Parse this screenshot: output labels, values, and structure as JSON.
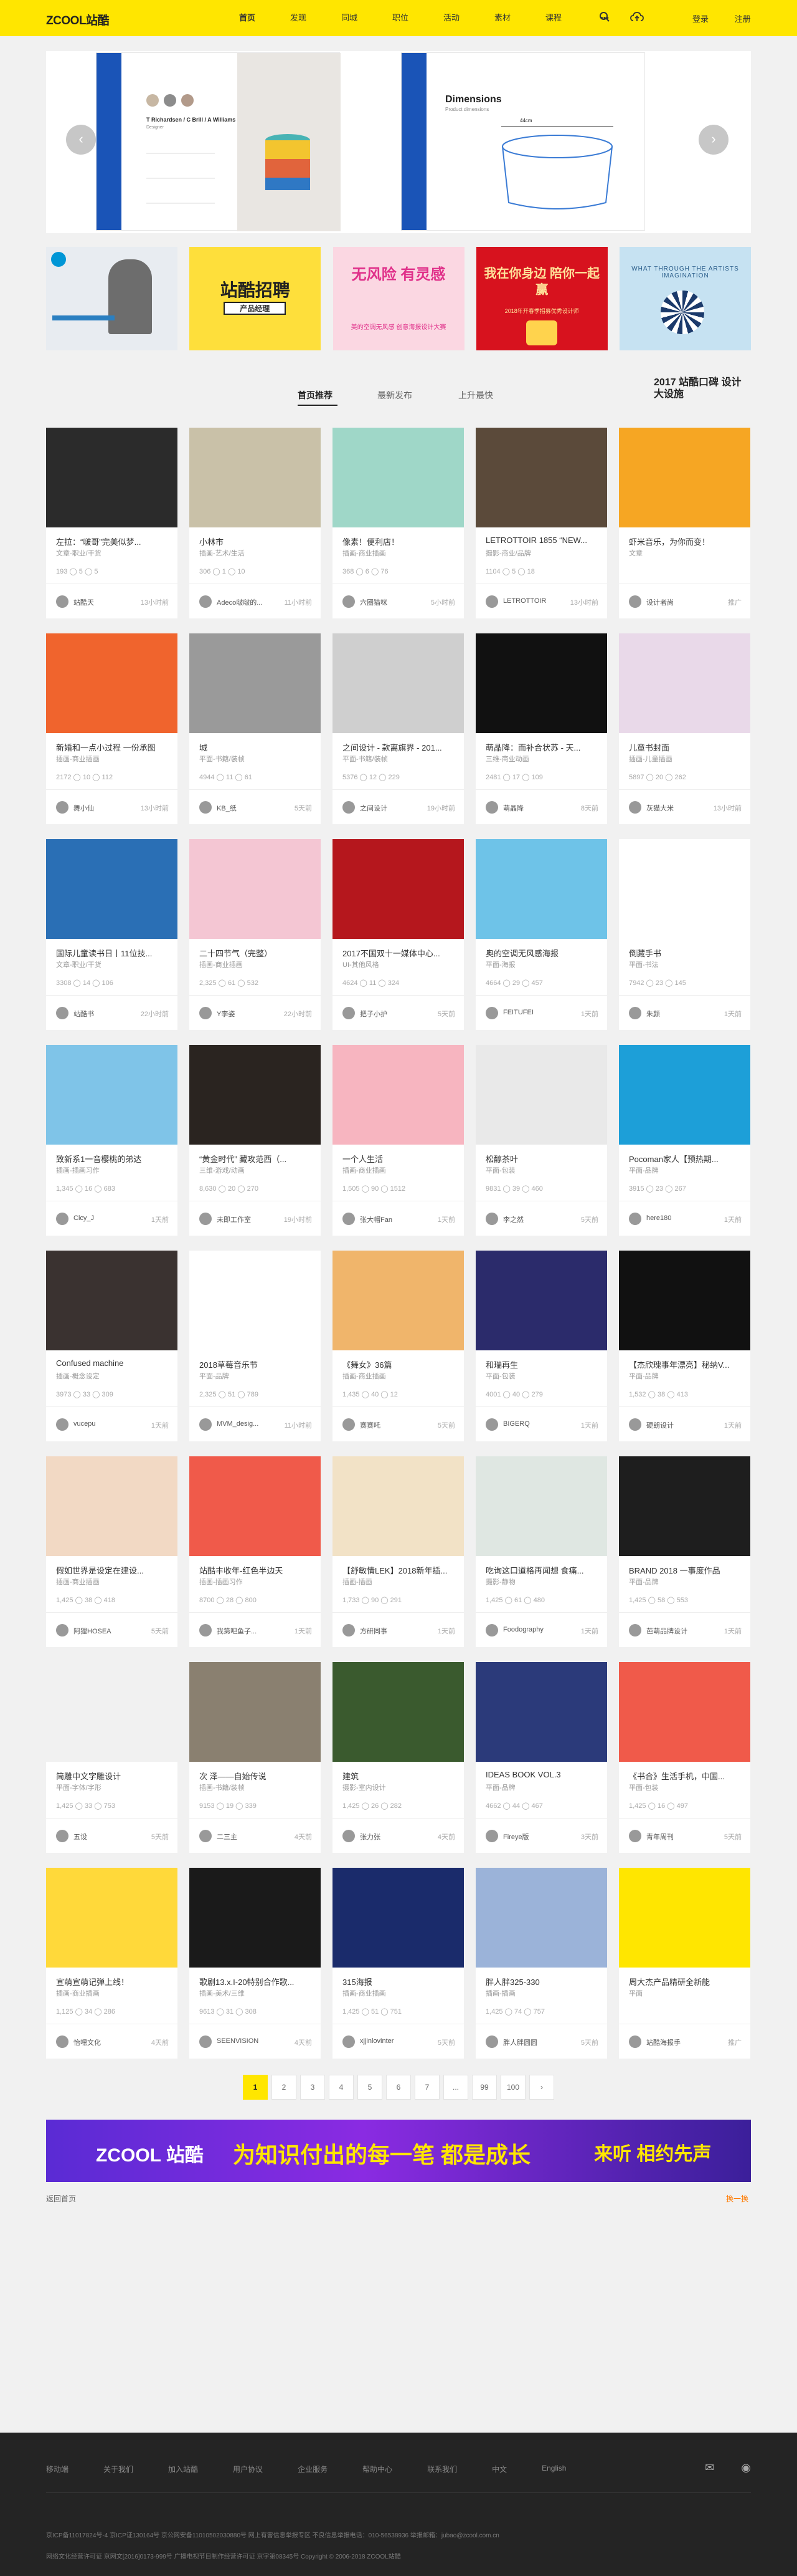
{
  "header": {
    "logo_en": "ZCOOL",
    "logo_cn": "站酷",
    "nav": [
      "首页",
      "发现",
      "同城",
      "职位",
      "活动",
      "素材",
      "课程"
    ],
    "more": "•••",
    "login": "登录",
    "register": "注册"
  },
  "banner": {
    "card1_name": "T Richardsen / C Brill / A Williams",
    "card1_role": "Designer",
    "card2_title": "Dimensions",
    "card2_sub": "Product dimensions",
    "card2_measure": "44cm"
  },
  "ads": [
    {
      "text": ""
    },
    {
      "text": "站酷招聘",
      "sub": "产品经理"
    },
    {
      "text": "无风险 有灵感",
      "sub": "美的空调无风感 创意海报设计大赛"
    },
    {
      "text": "我在你身边 陪你一起赢",
      "sub": "2018年开春季招募优秀设计师"
    },
    {
      "text": "WHAT THROUGH THE ARTISTS IMAGINATION"
    }
  ],
  "tabs": {
    "t1": "首页推荐",
    "t2": "最新发布",
    "t3": "上升最快",
    "badge": "2017 站酷口碑 设计 大设施"
  },
  "cards": [
    [
      {
        "title": "左拉：“啵哥”完美似梦...",
        "cat": "文章-职业/干货",
        "s": "193 ◯ 5 ◯ 5",
        "au": "站酷天",
        "tm": "13小时前"
      },
      {
        "title": "小林市",
        "cat": "插画-艺术/生活",
        "s": "306 ◯ 1 ◯ 10",
        "au": "Adeco啵啵的...",
        "tm": "11小时前"
      },
      {
        "title": "像素！便利店！",
        "cat": "插画-商业插画",
        "s": "368 ◯ 6 ◯ 76",
        "au": "六圈猫咪",
        "tm": "5小时前"
      },
      {
        "title": "LETROTTOIR 1855 “NEW...",
        "cat": "摄影-商业/品牌",
        "s": "1104 ◯ 5 ◯ 18",
        "au": "LETROTTOIR",
        "tm": "13小时前"
      },
      {
        "title": "虾米音乐，为你而变！",
        "cat": "文章",
        "s": "",
        "au": "设计者尚",
        "tm": "推广"
      }
    ],
    [
      {
        "title": "新婚和一点小过程 一份承图",
        "cat": "插画-商业插画",
        "s": "2172 ◯ 10 ◯ 112",
        "au": "舞小仙",
        "tm": "13小时前"
      },
      {
        "title": "城",
        "cat": "平面-书籍/装帧",
        "s": "4944 ◯ 11 ◯ 61",
        "au": "KB_纸",
        "tm": "5天前"
      },
      {
        "title": "之间设计 - 款离旗界 - 201...",
        "cat": "平面-书籍/装帧",
        "s": "5376 ◯ 12 ◯ 229",
        "au": "之间设计",
        "tm": "19小时前"
      },
      {
        "title": "萌晶降：而补合状苏 - 天...",
        "cat": "三维-商业动画",
        "s": "2481 ◯ 17 ◯ 109",
        "au": "萌晶降",
        "tm": "8天前"
      },
      {
        "title": "儿童书封面",
        "cat": "插画-儿童插画",
        "s": "5897 ◯ 20 ◯ 262",
        "au": "灰猫大米",
        "tm": "13小时前"
      }
    ],
    [
      {
        "title": "国际儿童读书日丨11位技...",
        "cat": "文章-职业/干货",
        "s": "3308 ◯ 14 ◯ 106",
        "au": "站酷书",
        "tm": "22小时前"
      },
      {
        "title": "二十四节气（完整）",
        "cat": "插画-商业插画",
        "s": "2,325 ◯ 61 ◯ 532",
        "au": "Y李姿",
        "tm": "22小时前"
      },
      {
        "title": "2017不国双十一媒体中心...",
        "cat": "UI-其他风格",
        "s": "4624 ◯ 11 ◯ 324",
        "au": "把子小护",
        "tm": "5天前"
      },
      {
        "title": "奥的空调无风感海报",
        "cat": "平面-海报",
        "s": "4664 ◯ 29 ◯ 457",
        "au": "FEITUFEI",
        "tm": "1天前"
      },
      {
        "title": "倒藏手书",
        "cat": "平面-书法",
        "s": "7942 ◯ 23 ◯ 145",
        "au": "朱颜",
        "tm": "1天前"
      }
    ],
    [
      {
        "title": "致新系1一音樱桃的弟达",
        "cat": "插画-插画习作",
        "s": "1,345 ◯ 16 ◯ 683",
        "au": "Cicy_J",
        "tm": "1天前"
      },
      {
        "title": "“黄金时代” 藏攻范西（...",
        "cat": "三维-游戏/动画",
        "s": "8,630 ◯ 20 ◯ 270",
        "au": "未即工作室",
        "tm": "19小时前"
      },
      {
        "title": "一个人生活",
        "cat": "插画-商业插画",
        "s": "1,505 ◯ 90 ◯ 1512",
        "au": "张大帽Fan",
        "tm": "1天前"
      },
      {
        "title": "松醇茶叶",
        "cat": "平面-包装",
        "s": "9831 ◯ 39 ◯ 460",
        "au": "李之然",
        "tm": "5天前"
      },
      {
        "title": "Pocoman家人【预热期...",
        "cat": "平面-品牌",
        "s": "3915 ◯ 23 ◯ 267",
        "au": "here180",
        "tm": "1天前"
      }
    ],
    [
      {
        "title": "Confused machine",
        "cat": "插画-概念设定",
        "s": "3973 ◯ 33 ◯ 309",
        "au": "vucepu",
        "tm": "1天前"
      },
      {
        "title": "2018草莓音乐节",
        "cat": "平面-品牌",
        "s": "2,325 ◯ 51 ◯ 789",
        "au": "MVM_desig...",
        "tm": "11小时前"
      },
      {
        "title": "《舞女》36篇",
        "cat": "插画-商业插画",
        "s": "1,435 ◯ 40 ◯ 12",
        "au": "赛赛吒",
        "tm": "5天前"
      },
      {
        "title": "和瑞再生",
        "cat": "平面-包装",
        "s": "4001 ◯ 40 ◯ 279",
        "au": "BIGERQ",
        "tm": "1天前"
      },
      {
        "title": "【杰欣瑰事年漂亮】秘纳V...",
        "cat": "平面-品牌",
        "s": "1,532 ◯ 38 ◯ 413",
        "au": "硬朗设计",
        "tm": "1天前"
      }
    ],
    [
      {
        "title": "假如世界是设定在建设...",
        "cat": "插画-商业插画",
        "s": "1,425 ◯ 38 ◯ 418",
        "au": "阿狸HOSEA",
        "tm": "5天前"
      },
      {
        "title": "站酷丰收年-红色半边天",
        "cat": "插画-插画习作",
        "s": "8700 ◯ 28 ◯ 800",
        "au": "我第吧鱼子...",
        "tm": "1天前"
      },
      {
        "title": "【舒敏情LEK】2018新年插...",
        "cat": "插画-插画",
        "s": "1,733 ◯ 90 ◯ 291",
        "au": "方研同事",
        "tm": "1天前"
      },
      {
        "title": "吃询这口道格再闻想 食痛...",
        "cat": "摄影-静物",
        "s": "1,425 ◯ 61 ◯ 480",
        "au": "Foodography",
        "tm": "1天前"
      },
      {
        "title": "BRAND 2018 一事度作品",
        "cat": "平面-品牌",
        "s": "1,425 ◯ 58 ◯ 553",
        "au": "芭萌品牌设计",
        "tm": "1天前"
      }
    ],
    [
      {
        "title": "简雕中文字雕设计",
        "cat": "平面-字体/字形",
        "s": "1,425 ◯ 33 ◯ 753",
        "au": "五设",
        "tm": "5天前"
      },
      {
        "title": "次 泽——自始传说",
        "cat": "插画-书籍/装帧",
        "s": "9153 ◯ 19 ◯ 339",
        "au": "二三主",
        "tm": "4天前"
      },
      {
        "title": "建筑",
        "cat": "摄影-室内设计",
        "s": "1,425 ◯ 26 ◯ 282",
        "au": "张力张",
        "tm": "4天前"
      },
      {
        "title": "IDEAS BOOK VOL.3",
        "cat": "平面-品牌",
        "s": "4662 ◯ 44 ◯ 467",
        "au": "Fireye版",
        "tm": "3天前"
      },
      {
        "title": "《书合》生活手机，中国...",
        "cat": "平面-包装",
        "s": "1,425 ◯ 16 ◯ 497",
        "au": "青年周刊",
        "tm": "5天前"
      }
    ],
    [
      {
        "title": "宣萌宣萌记弹上线！",
        "cat": "插画-商业插画",
        "s": "1,125 ◯ 34 ◯ 286",
        "au": "怡嘿文化",
        "tm": "4天前"
      },
      {
        "title": "歌剧13.x.I-20特别合作歌...",
        "cat": "插画-美术/三维",
        "s": "9613 ◯ 31 ◯ 308",
        "au": "SEENVISION",
        "tm": "4天前"
      },
      {
        "title": "315海报",
        "cat": "插画-商业插画",
        "s": "1,425 ◯ 51 ◯ 751",
        "au": "xjjinlovinter",
        "tm": "5天前"
      },
      {
        "title": "胖人胖325-330",
        "cat": "插画-插画",
        "s": "1,425 ◯ 74 ◯ 757",
        "au": "胖人胖圆圆",
        "tm": "5天前"
      },
      {
        "title": "周大杰产品精研全新能",
        "cat": "平面",
        "s": "",
        "au": "站酷海报手",
        "tm": "推广"
      }
    ]
  ],
  "pager": [
    "1",
    "2",
    "3",
    "4",
    "5",
    "6",
    "7",
    "...",
    "99",
    "100",
    "›"
  ],
  "promo": {
    "logo": "ZCOOL 站酷",
    "slogan": "为知识付出的每一笔 都是成长",
    "right": "来听 相约先声"
  },
  "below": {
    "back": "返回首页",
    "swap": "换一换"
  },
  "footer": {
    "nav": [
      "移动端",
      "关于我们",
      "加入站酷",
      "用户协议",
      "企业服务",
      "帮助中心",
      "联系我们",
      "中文",
      "English"
    ],
    "info1": "京ICP备11017824号-4    京ICP证130164号    京公网安备11010502030880号    网上有害信息举报专区    不良信息举报电话：010-56538936    举报邮箱：jubao@zcool.com.cn",
    "info2": "网络文化经营许可证 京网文[2016]0173-999号    广播电视节目制作经营许可证 京字第08345号    Copyright © 2006-2018 ZCOOL站酷"
  }
}
